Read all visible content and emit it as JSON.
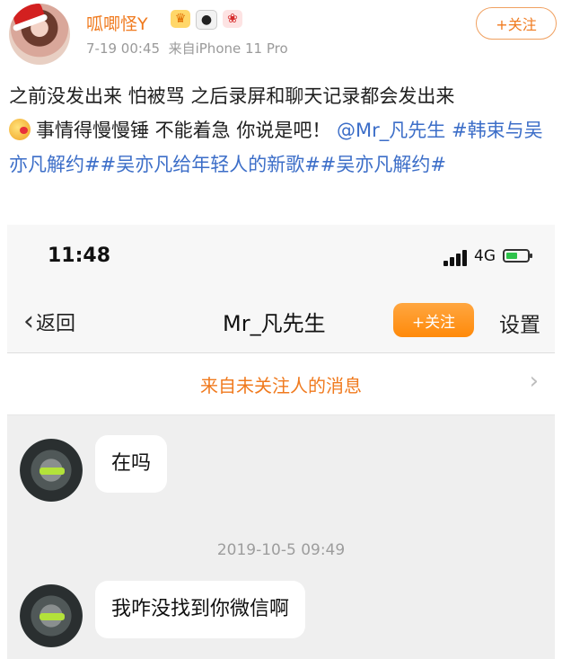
{
  "post": {
    "username": "呱唧怪Y",
    "badges": [
      "crown-badge",
      "panda-badge",
      "gift-badge"
    ],
    "time": "7-19 00:45",
    "source": "来自iPhone 11 Pro",
    "follow_label": "+关注",
    "text_line1": "之前没发出来 怕被骂 之后录屏和聊天记录都会发出来",
    "text_line2_plain": "事情得慢慢锤 不能着急 你说是吧！",
    "mention": "@Mr_凡先生",
    "hashtags_text": "#韩束与吴亦凡解约##吴亦凡给年轻人的新歌##吴亦凡解约#"
  },
  "screenshot": {
    "status_time": "11:48",
    "network": "4G",
    "back_label": "返回",
    "chat_title": "Mr_凡先生",
    "nav_follow_label": "+关注",
    "settings_label": "设置",
    "notice": "来自未关注人的消息",
    "messages": [
      {
        "text": "在吗"
      },
      {
        "timestamp": "2019-10-5 09:49"
      },
      {
        "text": "我咋没找到你微信啊"
      }
    ]
  },
  "colors": {
    "accent_orange": "#f07a1e",
    "link_blue": "#3c6ec8"
  }
}
